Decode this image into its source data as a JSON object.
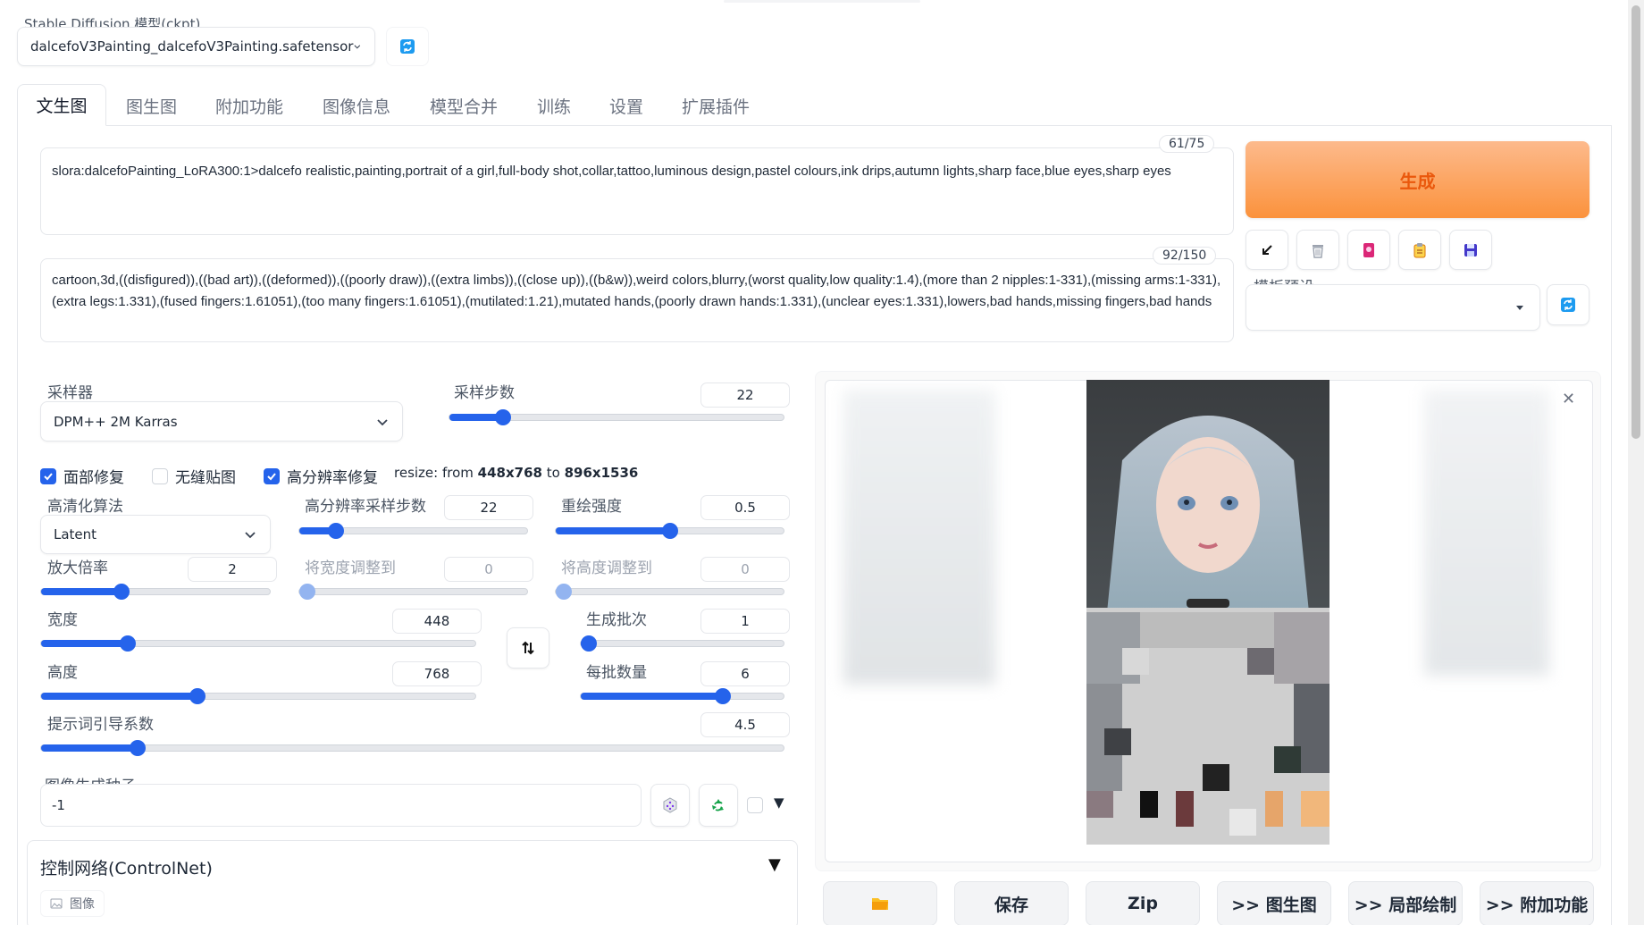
{
  "model": {
    "label": "Stable Diffusion 模型(ckpt)",
    "value": "dalcefoV3Painting_dalcefoV3Painting.safetensor"
  },
  "tabs": [
    "文生图",
    "图生图",
    "附加功能",
    "图像信息",
    "模型合并",
    "训练",
    "设置",
    "扩展插件"
  ],
  "prompt": {
    "text": "slora:dalcefoPainting_LoRA300:1>dalcefo realistic,painting,portrait of a girl,full-body shot,collar,tattoo,luminous design,pastel colours,ink drips,autumn lights,sharp face,blue eyes,sharp eyes",
    "token_count": "61/75"
  },
  "negative_prompt": {
    "text": "cartoon,3d,((disfigured)),((bad art)),((deformed)),((poorly draw)),((extra limbs)),((close up)),((b&w)),weird colors,blurry,(worst quality,low quality:1.4),(more than 2 nipples:1-331),(missing arms:1-331),(extra legs:1.331),(fused fingers:1.61051),(too many fingers:1.61051),(mutilated:1.21),mutated hands,(poorly drawn hands:1.331),(unclear eyes:1.331),lowers,bad hands,missing fingers,bad hands",
    "token_count": "92/150"
  },
  "generate": {
    "label": "生成",
    "color": "#f97316"
  },
  "style_preset": {
    "label": "模板预设",
    "value": ""
  },
  "sampler": {
    "label": "采样器",
    "value": "DPM++ 2M Karras"
  },
  "steps": {
    "label": "采样步数",
    "value": "22",
    "fraction": 0.16
  },
  "checkboxes": {
    "face_restore": {
      "label": "面部修复",
      "checked": true
    },
    "tiling": {
      "label": "无缝贴图",
      "checked": false
    },
    "hires_fix": {
      "label": "高分辨率修复",
      "checked": true
    }
  },
  "resize_info": {
    "prefix": "resize: from ",
    "from": "448x768",
    "middle": " to ",
    "to": "896x1536"
  },
  "upscaler": {
    "label": "高清化算法",
    "value": "Latent"
  },
  "hires_steps": {
    "label": "高分辨率采样步数",
    "value": "22",
    "fraction": 0.16
  },
  "denoise": {
    "label": "重绘强度",
    "value": "0.5",
    "fraction": 0.5
  },
  "upscale_by": {
    "label": "放大倍率",
    "value": "2",
    "fraction": 0.35
  },
  "resize_width": {
    "label": "将宽度调整到",
    "value": "0",
    "fraction": 0.0
  },
  "resize_height": {
    "label": "将高度调整到",
    "value": "0",
    "fraction": 0.0
  },
  "width": {
    "label": "宽度",
    "value": "448",
    "fraction": 0.2
  },
  "height": {
    "label": "高度",
    "value": "768",
    "fraction": 0.36
  },
  "batch_count": {
    "label": "生成批次",
    "value": "1",
    "fraction": 0.03
  },
  "batch_size": {
    "label": "每批数量",
    "value": "6",
    "fraction": 0.7
  },
  "cfg": {
    "label": "提示词引导系数",
    "value": "4.5",
    "fraction": 0.13
  },
  "seed": {
    "label": "图像生成种子",
    "value": "-1"
  },
  "controlnet": {
    "title": "控制网络(ControlNet)",
    "image_tab": "图像"
  },
  "output_buttons": {
    "save": "保存",
    "zip": "Zip",
    "to_img2img": ">> 图生图",
    "to_inpaint": ">> 局部绘制",
    "to_extras": ">> 附加功能"
  },
  "icons": {
    "refresh": "refresh-icon",
    "swap": "swap-icon",
    "dice": "dice-icon",
    "recycle": "recycle-icon",
    "folder": "folder-icon",
    "close": "close-icon"
  }
}
